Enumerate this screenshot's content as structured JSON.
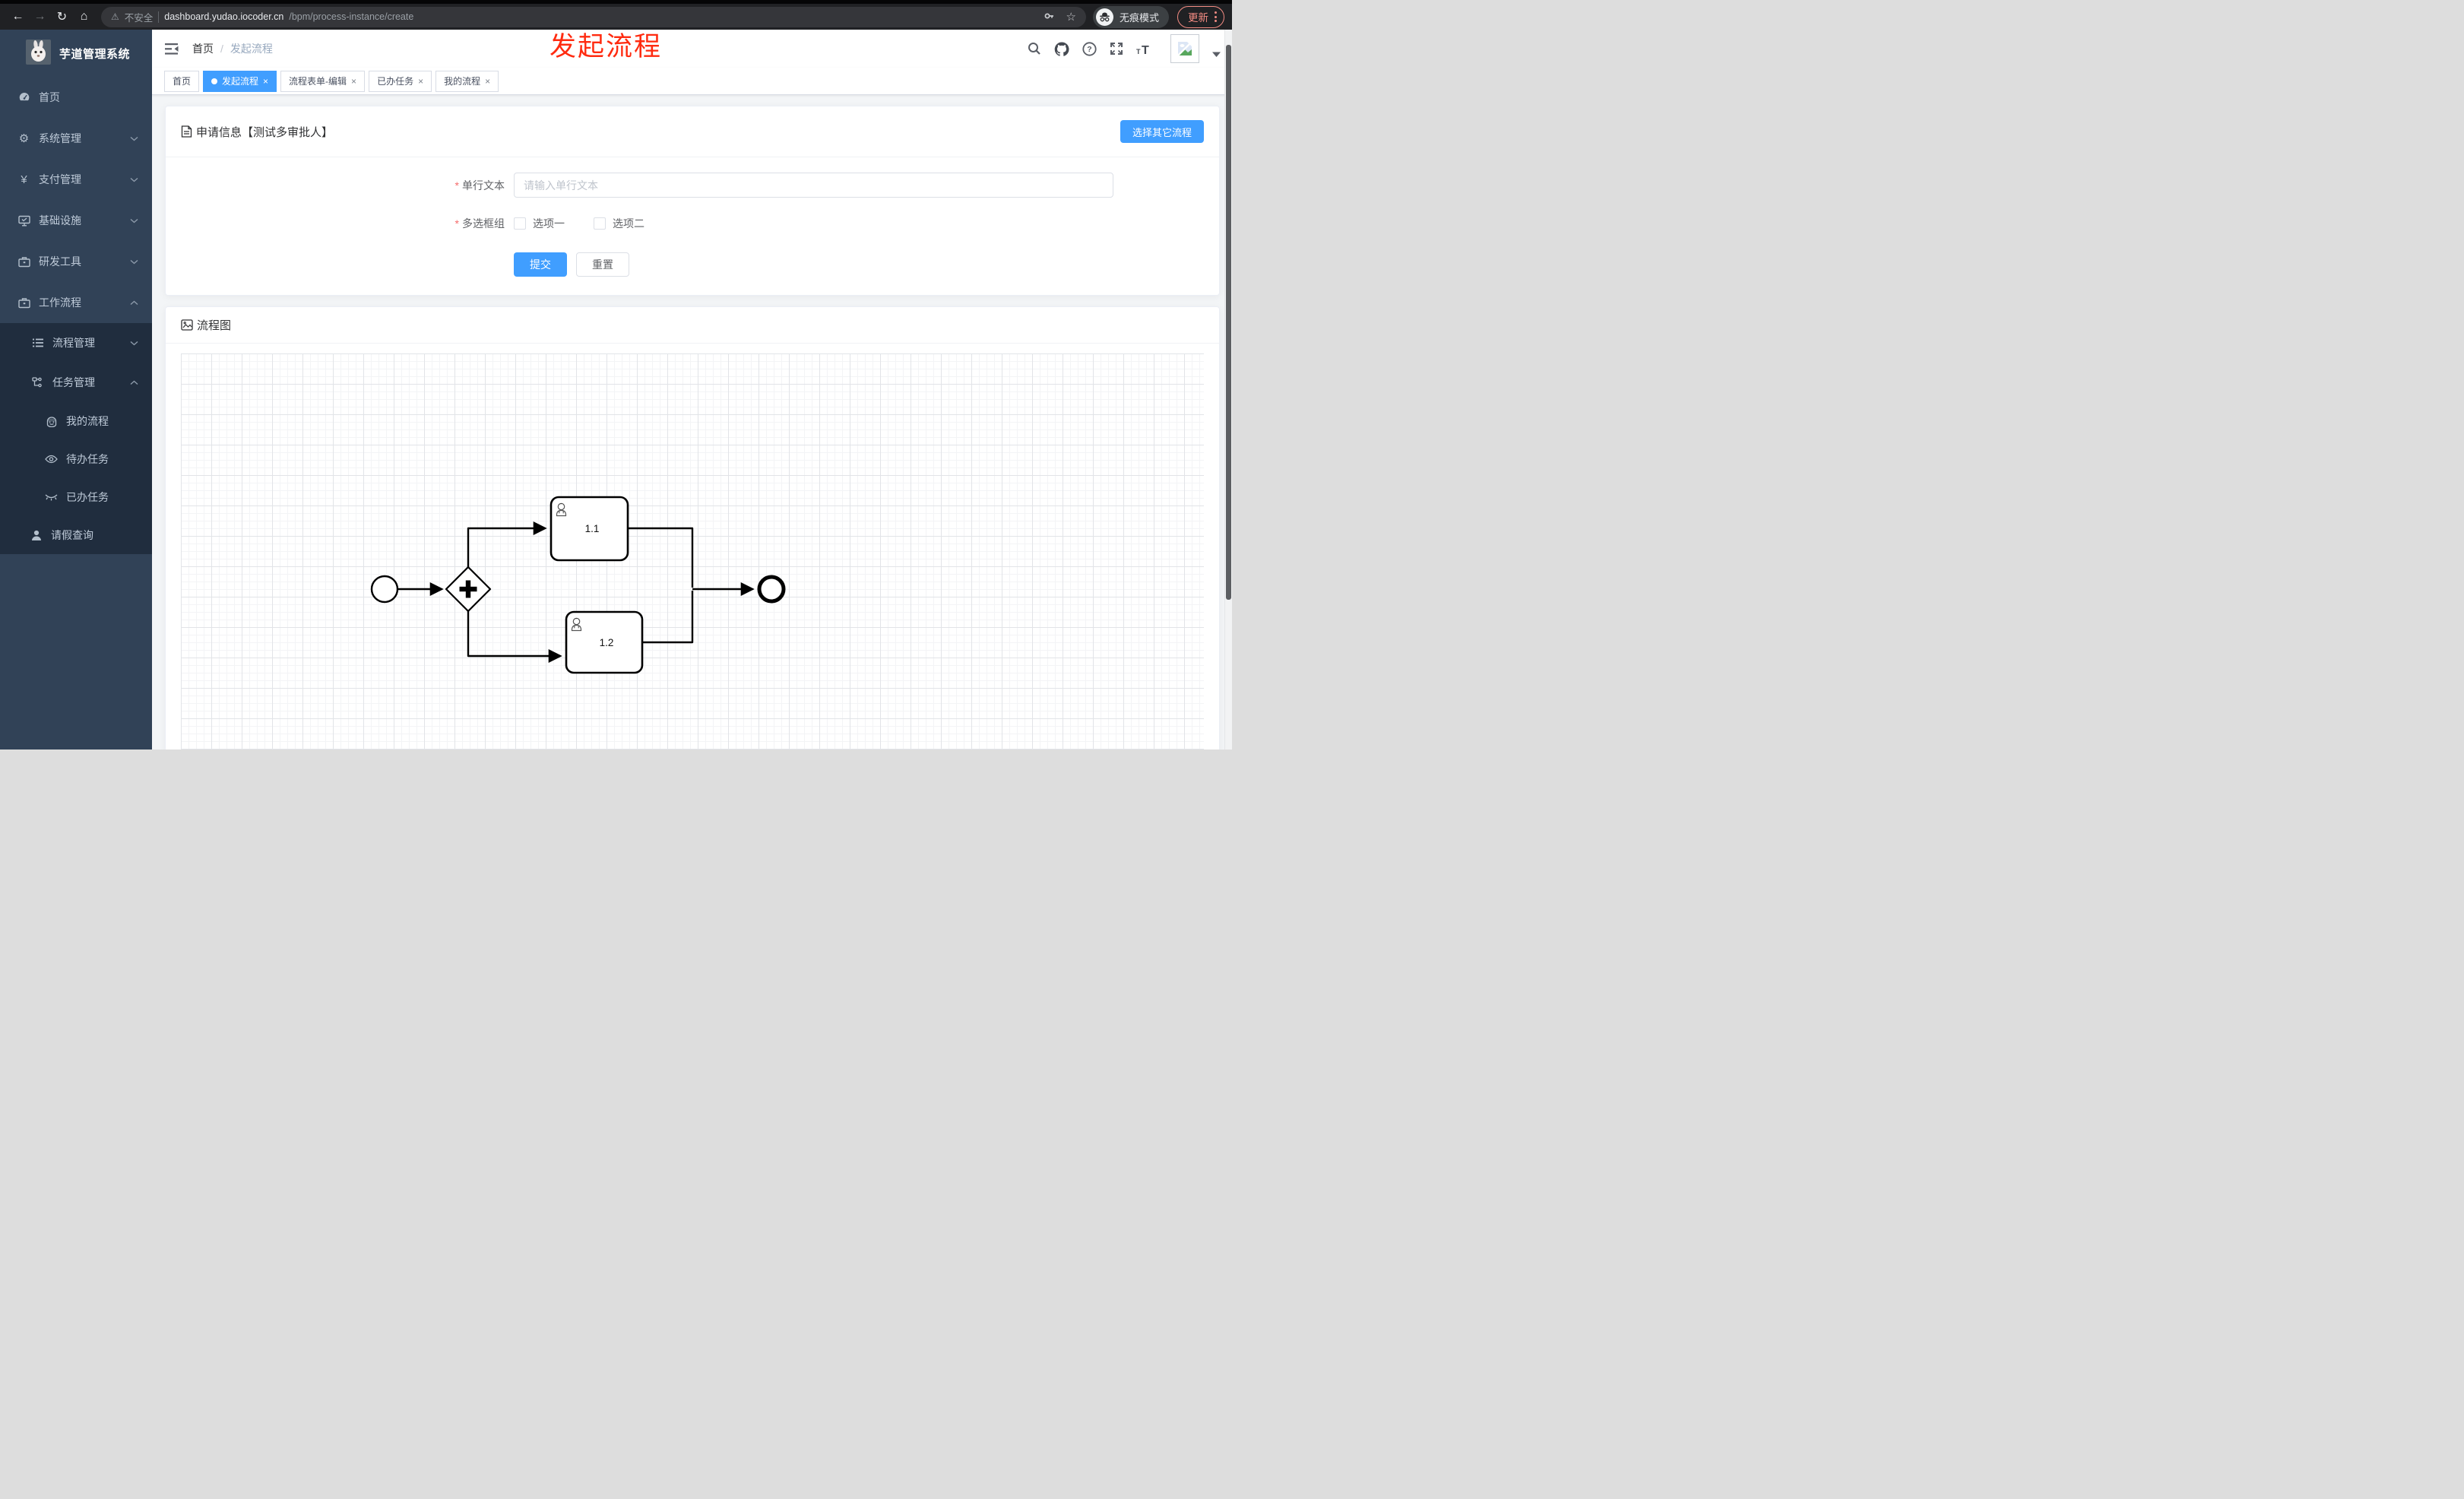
{
  "browser": {
    "warning_label": "不安全",
    "url_host": "dashboard.yudao.iocoder.cn",
    "url_path": "/bpm/process-instance/create",
    "incognito_label": "无痕模式",
    "update_label": "更新",
    "back_glyph": "←",
    "forward_glyph": "→",
    "reload_glyph": "↻",
    "home_glyph": "⌂",
    "warning_glyph": "⚠",
    "star_glyph": "☆"
  },
  "sidebar": {
    "title": "芋道管理系统",
    "items": [
      {
        "label": "首页"
      },
      {
        "label": "系统管理"
      },
      {
        "label": "支付管理"
      },
      {
        "label": "基础设施"
      },
      {
        "label": "研发工具"
      },
      {
        "label": "工作流程"
      },
      {
        "label": "流程管理"
      },
      {
        "label": "任务管理"
      },
      {
        "label": "我的流程"
      },
      {
        "label": "待办任务"
      },
      {
        "label": "已办任务"
      },
      {
        "label": "请假查询"
      }
    ],
    "gear_glyph": "⚙",
    "yen_glyph": "¥"
  },
  "navbar": {
    "breadcrumb_home": "首页",
    "breadcrumb_sep": "/",
    "breadcrumb_current": "发起流程"
  },
  "tabs": [
    {
      "label": "首页"
    },
    {
      "label": "发起流程"
    },
    {
      "label": "流程表单-编辑"
    },
    {
      "label": "已办任务"
    },
    {
      "label": "我的流程"
    }
  ],
  "close_glyph": "×",
  "annotation_text": "发起流程",
  "apply_card": {
    "title": "申请信息【测试多审批人】",
    "choose_button": "选择其它流程",
    "required_mark": "*",
    "text_field_label": "单行文本",
    "text_field_placeholder": "请输入单行文本",
    "checkbox_group_label": "多选框组",
    "option1": "选项一",
    "option2": "选项二",
    "submit_label": "提交",
    "reset_label": "重置"
  },
  "diagram_card": {
    "title": "流程图",
    "task1_label": "1.1",
    "task2_label": "1.2"
  },
  "colors": {
    "accent_blue": "#409eff",
    "annotation_red": "#ff2b10",
    "sidebar_bg": "#314257",
    "submenu_bg": "#202d3e",
    "update_pill_red": "#f28b82"
  }
}
